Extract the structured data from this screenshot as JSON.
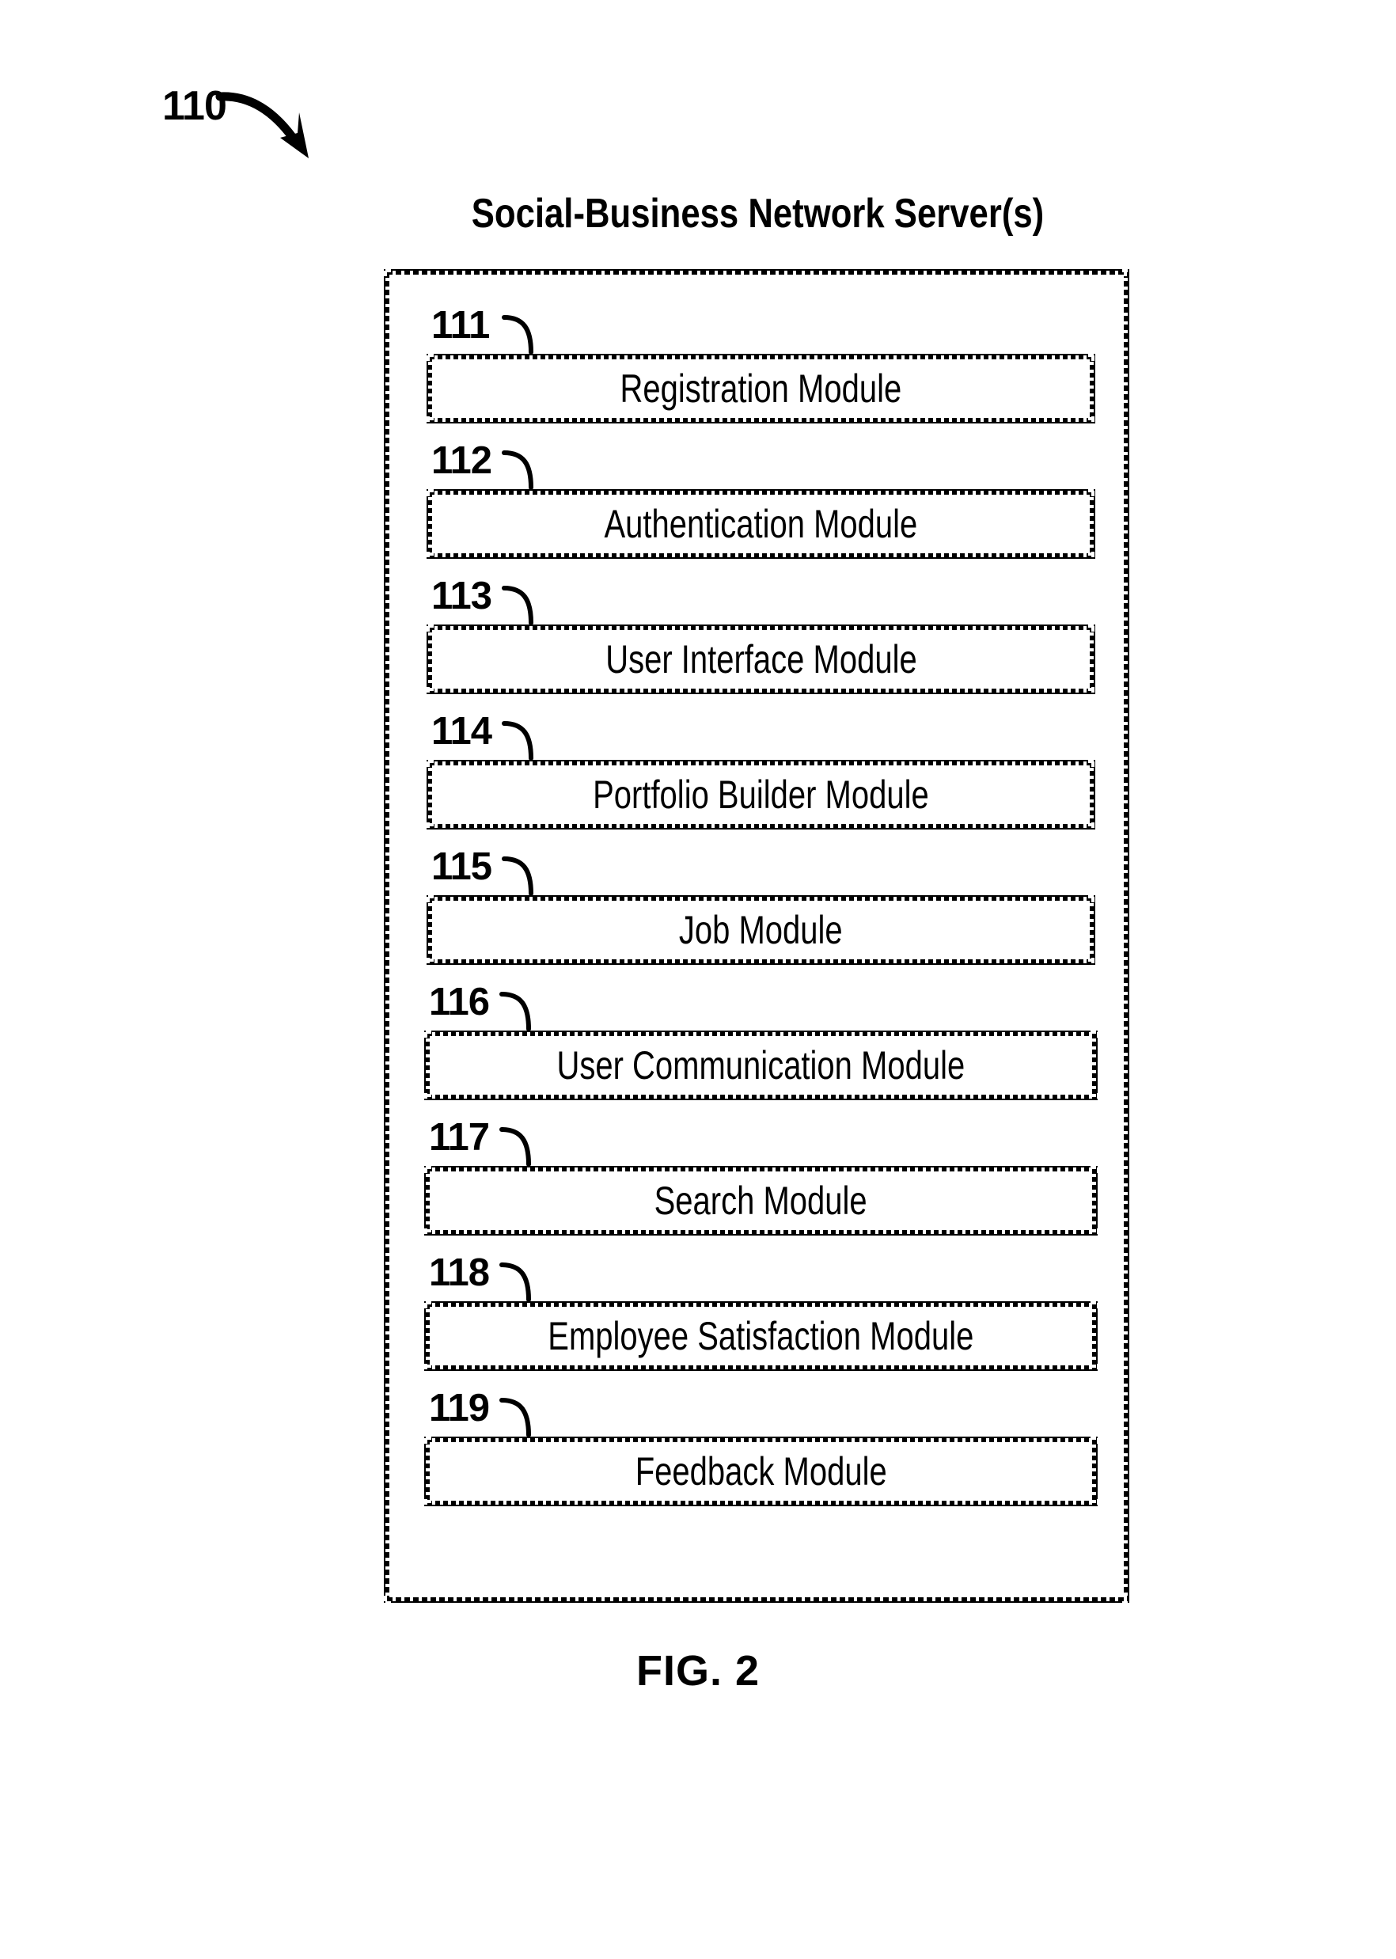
{
  "figure": {
    "reference_numeral": "110",
    "caption": "FIG. 2",
    "arrow_icon": "curved-arrow-icon"
  },
  "server_block": {
    "title": "Social-Business Network Server(s)",
    "modules": [
      {
        "number": "111",
        "label": "Registration Module"
      },
      {
        "number": "112",
        "label": "Authentication Module"
      },
      {
        "number": "113",
        "label": "User Interface Module"
      },
      {
        "number": "114",
        "label": "Portfolio Builder Module"
      },
      {
        "number": "115",
        "label": "Job Module"
      },
      {
        "number": "116",
        "label": "User Communication Module"
      },
      {
        "number": "117",
        "label": "Search Module"
      },
      {
        "number": "118",
        "label": "Employee Satisfaction Module"
      },
      {
        "number": "119",
        "label": "Feedback Module"
      }
    ]
  },
  "colors": {
    "ink": "#000000",
    "paper": "#ffffff"
  }
}
